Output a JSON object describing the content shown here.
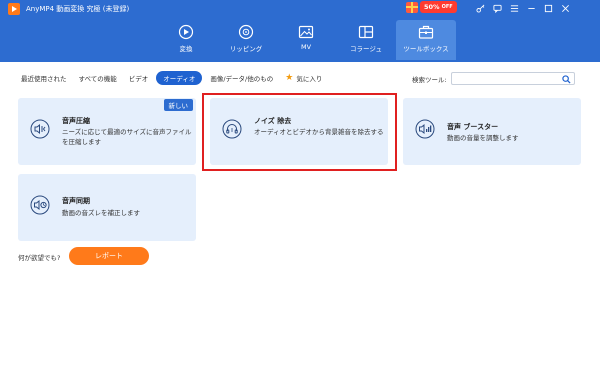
{
  "app": {
    "title": "AnyMP4 動画変換 究極 (未登録)"
  },
  "promo": {
    "badge_percent": "50%",
    "badge_off": "OFF"
  },
  "top_icons": [
    "key-icon",
    "feedback-icon",
    "menu-icon",
    "minimize-icon",
    "maximize-icon",
    "close-icon"
  ],
  "nav": {
    "items": [
      {
        "label": "変換",
        "icon": "convert-icon"
      },
      {
        "label": "リッピング",
        "icon": "disc-icon"
      },
      {
        "label": "MV",
        "icon": "image-icon"
      },
      {
        "label": "コラージュ",
        "icon": "collage-icon"
      },
      {
        "label": "ツールボックス",
        "icon": "toolbox-icon"
      }
    ],
    "active_index": 4
  },
  "filters": {
    "items": [
      "最近使用された",
      "すべての機能",
      "ビデオ",
      "オーディオ",
      "画像/データ/他のもの",
      "気に入り"
    ],
    "active": "オーディオ"
  },
  "search": {
    "label": "検索ツール:",
    "value": "",
    "placeholder": ""
  },
  "cards": [
    {
      "title": "音声圧縮",
      "desc1": "ニーズに応じて最適のサイズに音声ファイル",
      "desc2": "を圧縮します",
      "badge": "新しい",
      "icon": "audio-compress-icon"
    },
    {
      "title": "ノイズ 除去",
      "desc1": "オーディオとビデオから背景雑音を除去する",
      "desc2": "",
      "icon": "noise-remove-icon"
    },
    {
      "title": "音声 ブースター",
      "desc1": "動画の音量を調整します",
      "desc2": "",
      "icon": "volume-boost-icon"
    },
    {
      "title": "音声同期",
      "desc1": "動画の音ズレを補正します",
      "desc2": "",
      "icon": "audio-sync-icon"
    }
  ],
  "feedback": {
    "label": "何が欲望でも?",
    "button": "レポート"
  },
  "colors": {
    "header": "#2d6cd0",
    "accent": "#1f62d0",
    "card_bg": "#e5effc",
    "highlight": "#e02020",
    "report": "#ff7a1a"
  }
}
